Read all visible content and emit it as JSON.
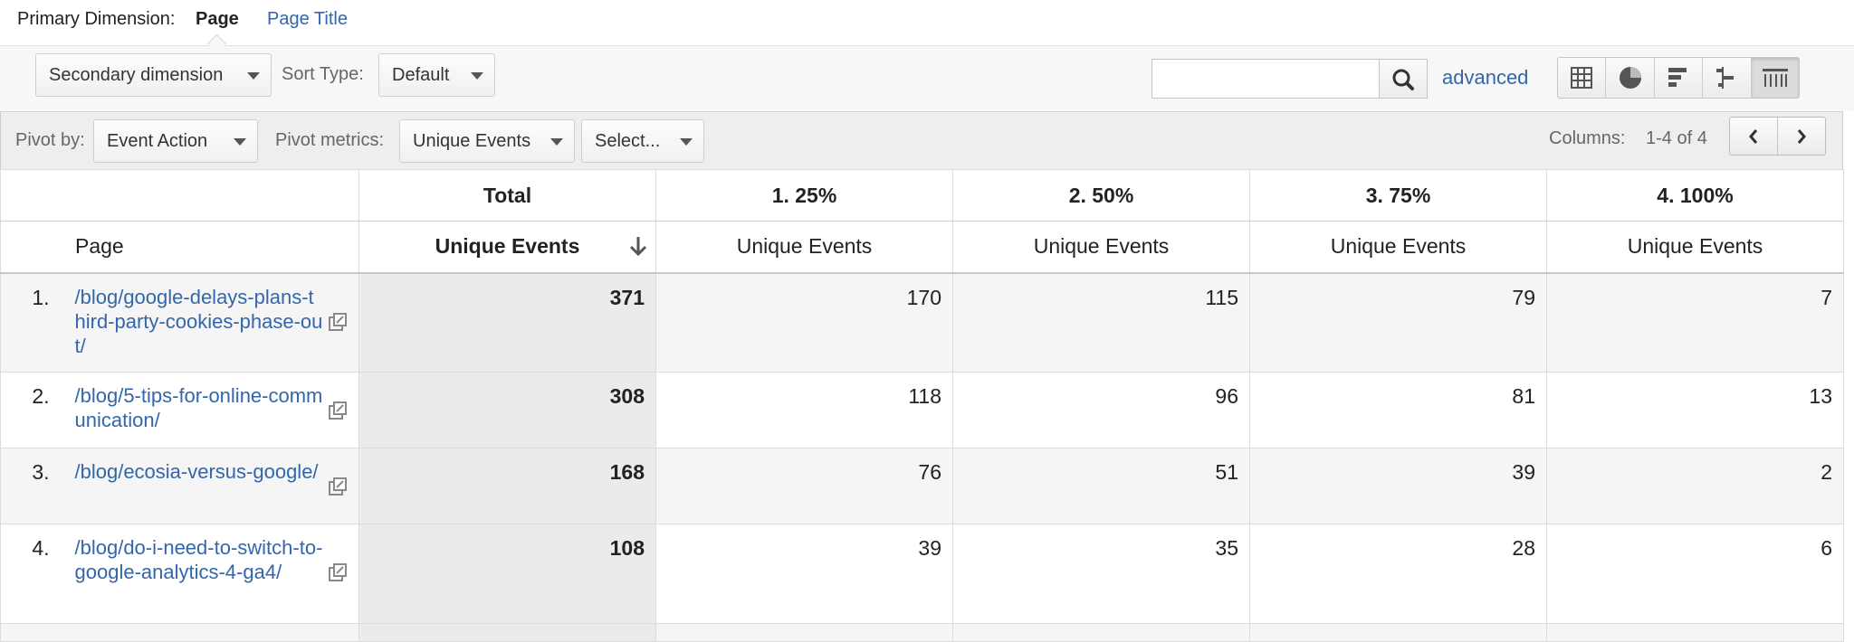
{
  "primary_dimension": {
    "label": "Primary Dimension:",
    "selected": "Page",
    "other": "Page Title"
  },
  "toolbar": {
    "secondary_dimension": "Secondary dimension",
    "sort_type_label": "Sort Type:",
    "sort_type_value": "Default",
    "search_value": "",
    "advanced_label": "advanced",
    "views": [
      "grid-view-icon",
      "pie-view-icon",
      "bar-view-icon",
      "comparison-view-icon",
      "pivot-view-icon"
    ],
    "active_view": "pivot-view-icon"
  },
  "pivot": {
    "pivot_by_label": "Pivot by:",
    "pivot_by_value": "Event Action",
    "metrics_label": "Pivot metrics:",
    "metric_value": "Unique Events",
    "metric_second": "Select...",
    "columns_label": "Columns:",
    "columns_value": "1-4 of 4"
  },
  "table": {
    "group_headers": [
      "Total",
      "1. 25%",
      "2. 50%",
      "3. 75%",
      "4. 100%"
    ],
    "page_header": "Page",
    "metric_header": "Unique Events",
    "rows": [
      {
        "index": "1.",
        "page": "/blog/google-delays-plans-third-party-cookies-phase-out/",
        "total": "371",
        "values": [
          "170",
          "115",
          "79",
          "7"
        ]
      },
      {
        "index": "2.",
        "page": "/blog/5-tips-for-online-communication/",
        "total": "308",
        "values": [
          "118",
          "96",
          "81",
          "13"
        ]
      },
      {
        "index": "3.",
        "page": "/blog/ecosia-versus-google/",
        "total": "168",
        "values": [
          "76",
          "51",
          "39",
          "2"
        ]
      },
      {
        "index": "4.",
        "page": "/blog/do-i-need-to-switch-to-google-analytics-4-ga4/",
        "total": "108",
        "values": [
          "39",
          "35",
          "28",
          "6"
        ]
      }
    ]
  },
  "colors": {
    "link": "#3366aa",
    "toolbar_bg": "#f7f7f7",
    "pivot_bg": "#eeeeee"
  }
}
